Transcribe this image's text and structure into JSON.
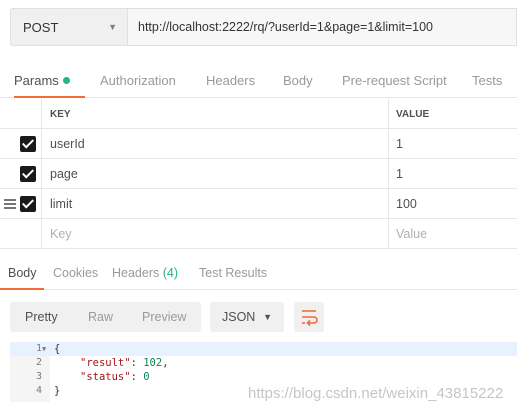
{
  "request": {
    "method": "POST",
    "url": "http://localhost:2222/rq/?userId=1&page=1&limit=100"
  },
  "request_tabs": [
    {
      "label": "Params"
    },
    {
      "label": "Authorization"
    },
    {
      "label": "Headers"
    },
    {
      "label": "Body"
    },
    {
      "label": "Pre-request Script"
    },
    {
      "label": "Tests"
    }
  ],
  "params": {
    "key_header": "KEY",
    "value_header": "VALUE",
    "rows": [
      {
        "key": "userId",
        "value": "1",
        "checked": true
      },
      {
        "key": "page",
        "value": "1",
        "checked": true
      },
      {
        "key": "limit",
        "value": "100",
        "checked": true
      }
    ],
    "key_placeholder": "Key",
    "value_placeholder": "Value"
  },
  "response_tabs": {
    "body": "Body",
    "cookies": "Cookies",
    "headers": "Headers",
    "headers_count": "(4)",
    "test_results": "Test Results"
  },
  "response_toolbar": {
    "pretty": "Pretty",
    "raw": "Raw",
    "preview": "Preview",
    "format": "JSON"
  },
  "code": {
    "lines": [
      {
        "num": "1",
        "text": "{"
      },
      {
        "num": "2",
        "key": "\"result\"",
        "value": "102",
        "sep": ": ",
        "tail": ","
      },
      {
        "num": "3",
        "key": "\"status\"",
        "value": "0",
        "sep": ": ",
        "tail": ""
      },
      {
        "num": "4",
        "text": "}"
      }
    ]
  },
  "watermark": "https://blog.csdn.net/weixin_43815222",
  "colors": {
    "accent": "#f26b3a",
    "green": "#26b47f"
  }
}
